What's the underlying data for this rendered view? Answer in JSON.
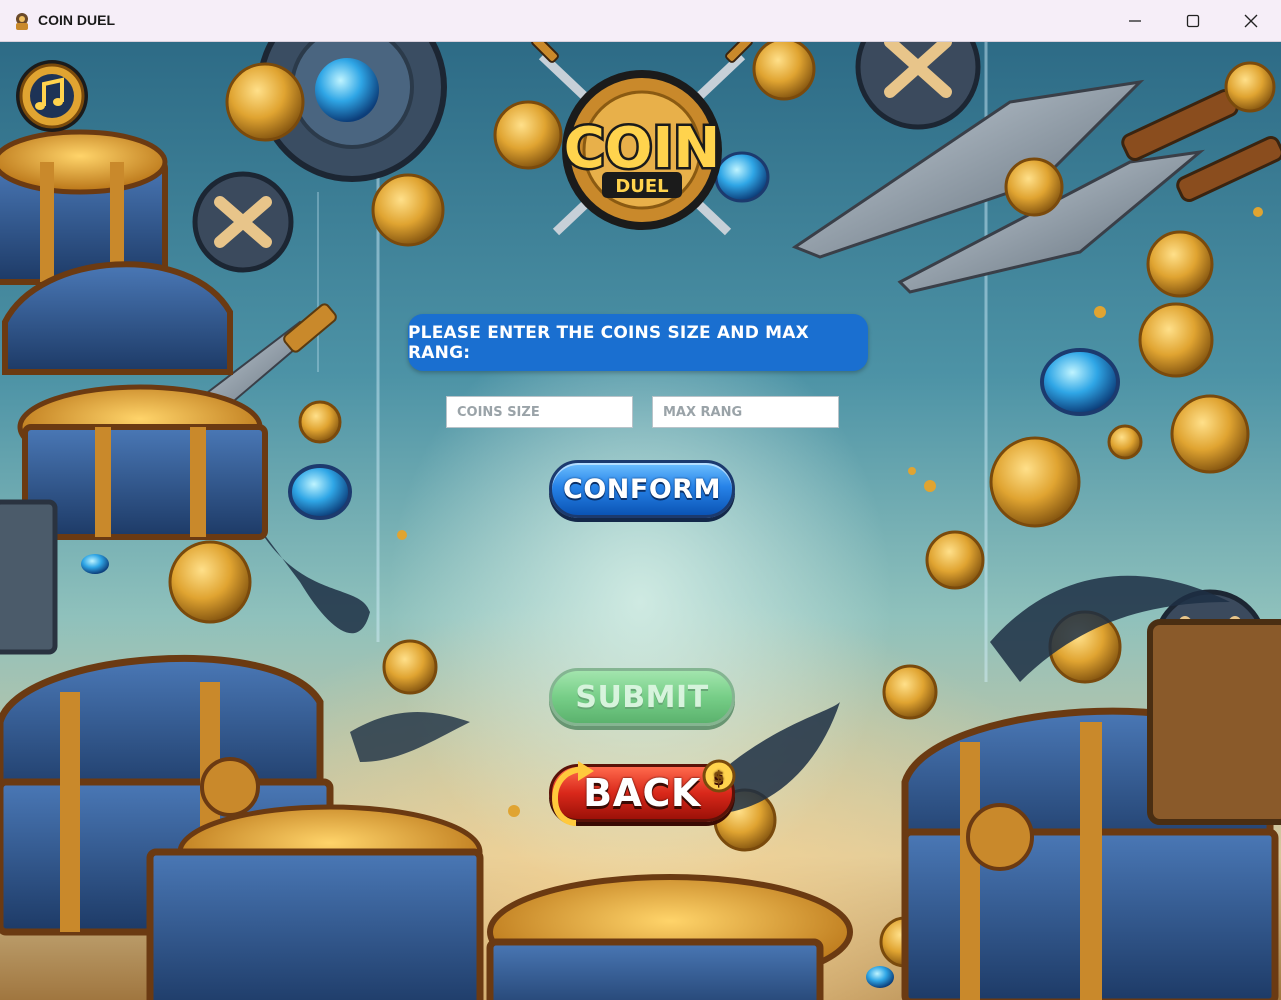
{
  "window": {
    "title": "COIN DUEL",
    "controls": [
      "minimize",
      "maximize",
      "close"
    ]
  },
  "logo": {
    "word_main": "COIN",
    "word_sub": "DUEL"
  },
  "music_button": {
    "icon": "music-note-icon"
  },
  "prompt": {
    "text": "PLEASE ENTER THE COINS SIZE AND MAX RANG:"
  },
  "inputs": {
    "coins_size": {
      "value": "",
      "placeholder": "COINS SIZE"
    },
    "max_rang": {
      "value": "",
      "placeholder": "MAX RANG"
    }
  },
  "buttons": {
    "conform": "CONFORM",
    "submit": "SUBMIT",
    "back": "BACK"
  },
  "colors": {
    "prompt_bg": "#1a6fd0",
    "conform": "#2783e8",
    "submit": "#6ccd7f",
    "back": "#d9281a",
    "gold": "#e0a431"
  }
}
